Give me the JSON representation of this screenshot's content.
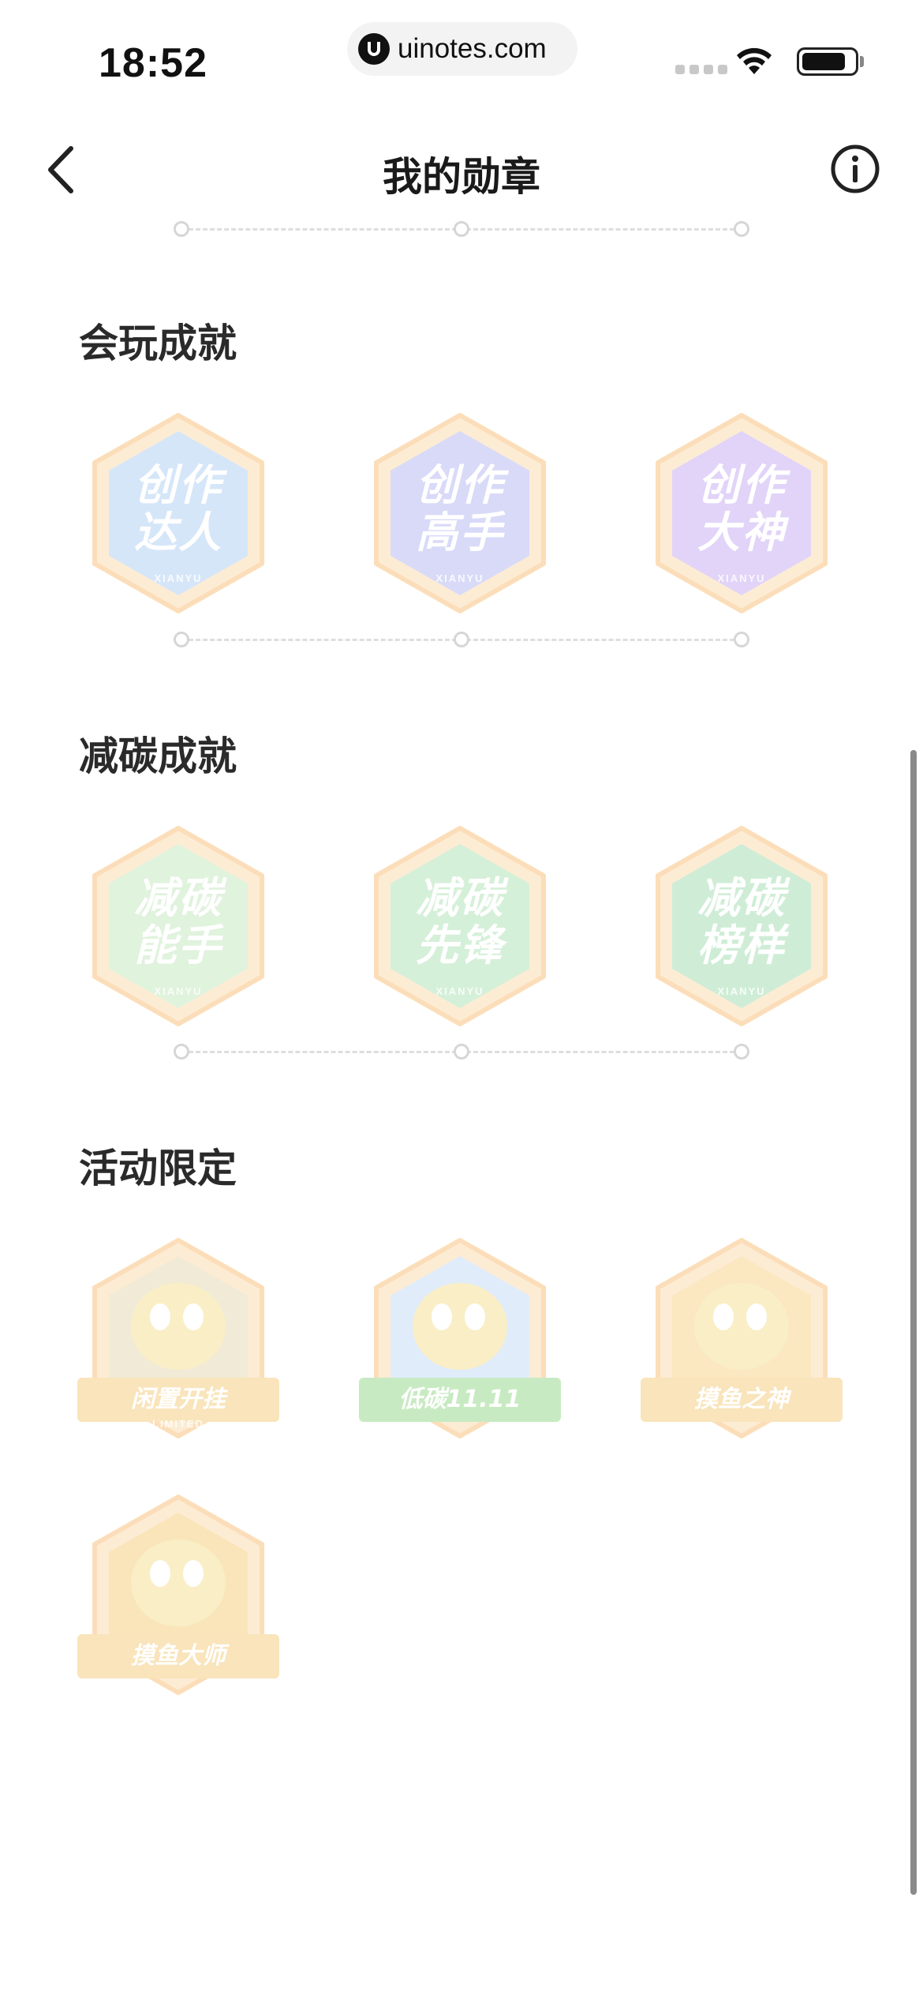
{
  "status_bar": {
    "time": "18:52",
    "url": "uinotes.com"
  },
  "nav": {
    "title": "我的勋章"
  },
  "sections": [
    {
      "title": "会玩成就",
      "badges": [
        {
          "name": "创作达人",
          "line1": "创作",
          "line2": "达人",
          "sub": "XIANYU",
          "color": "#9fc4f2"
        },
        {
          "name": "创作高手",
          "line1": "创作",
          "line2": "高手",
          "sub": "XIANYU",
          "color": "#a3a9f0"
        },
        {
          "name": "创作大神",
          "line1": "创作",
          "line2": "大神",
          "sub": "XIANYU",
          "color": "#b89af0"
        }
      ]
    },
    {
      "title": "减碳成就",
      "badges": [
        {
          "name": "减碳能手",
          "line1": "减碳",
          "line2": "能手",
          "sub": "XIANYU",
          "color": "#b6e3b0"
        },
        {
          "name": "减碳先锋",
          "line1": "减碳",
          "line2": "先锋",
          "sub": "XIANYU",
          "color": "#9ddca4"
        },
        {
          "name": "减碳榜样",
          "line1": "减碳",
          "line2": "榜样",
          "sub": "XIANYU",
          "color": "#8fd6a0"
        }
      ]
    },
    {
      "title": "活动限定",
      "badges": [
        {
          "name": "闲置开挂",
          "ribbon": "闲置开挂",
          "sub": "LIMITED",
          "color": "#e0cfa0"
        },
        {
          "name": "低碳11.11",
          "ribbon": "低碳11.11",
          "color": "#b7d2f5"
        },
        {
          "name": "摸鱼之神",
          "ribbon": "摸鱼之神",
          "color": "#f7c86a"
        },
        {
          "name": "摸鱼大师",
          "ribbon": "摸鱼大师",
          "color": "#f5c35c"
        }
      ]
    }
  ],
  "colors": {
    "accent_gold": "#f7c86a",
    "frame_orange": "#f6b25a",
    "divider": "#dedede"
  }
}
